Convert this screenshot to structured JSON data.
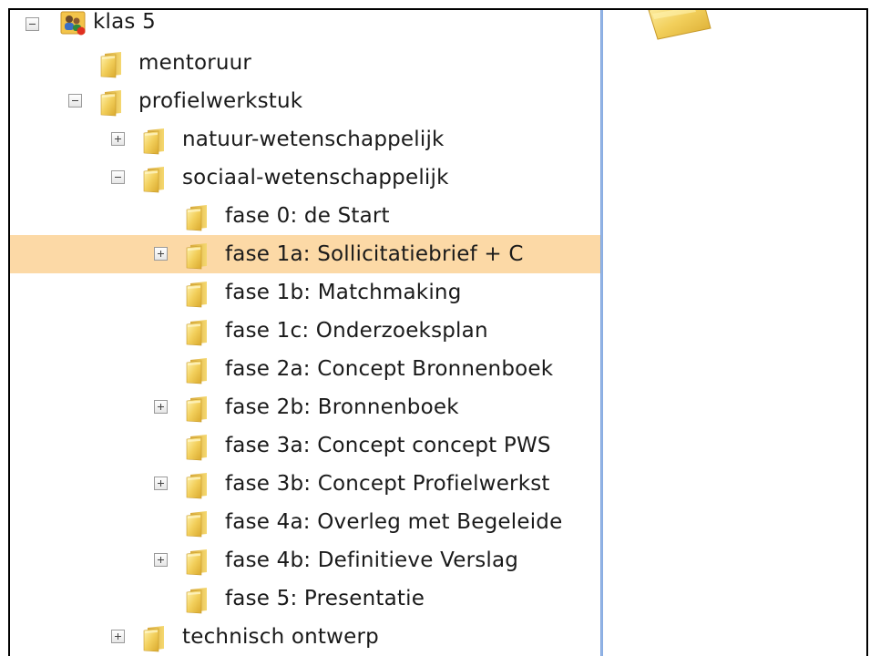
{
  "tree": {
    "root": {
      "label": "klas 5",
      "icon": "users-group-icon",
      "expanded": true
    },
    "mentoruur": {
      "label": "mentoruur",
      "icon": "folder-icon"
    },
    "profielwerkstuk": {
      "label": "profielwerkstuk",
      "icon": "folder-icon",
      "expanded": true
    },
    "natuur": {
      "label": "natuur-wetenschappelijk",
      "icon": "folder-icon",
      "expanded": false
    },
    "sociaal": {
      "label": "sociaal-wetenschappelijk",
      "icon": "folder-icon",
      "expanded": true
    },
    "fasen": [
      {
        "label": "fase 0: de Start",
        "expandable": false
      },
      {
        "label": "fase 1a: Sollicitatiebrief + C",
        "expandable": true,
        "selected": true
      },
      {
        "label": "fase 1b: Matchmaking",
        "expandable": false
      },
      {
        "label": "fase 1c: Onderzoeksplan",
        "expandable": false
      },
      {
        "label": "fase 2a: Concept Bronnenboek",
        "expandable": false
      },
      {
        "label": "fase 2b: Bronnenboek",
        "expandable": true
      },
      {
        "label": "fase 3a: Concept concept PWS",
        "expandable": false
      },
      {
        "label": "fase 3b: Concept Profielwerkst",
        "expandable": true
      },
      {
        "label": "fase 4a: Overleg met Begeleide",
        "expandable": false
      },
      {
        "label": "fase 4b: Definitieve Verslag",
        "expandable": true
      },
      {
        "label": "fase 5: Presentatie",
        "expandable": false
      }
    ],
    "technisch": {
      "label": "technisch ontwerp",
      "icon": "folder-icon",
      "expanded": false
    }
  },
  "colors": {
    "selection": "#fcd9a6",
    "splitter": "#7ea6df",
    "folder": "#f2cf5b"
  }
}
